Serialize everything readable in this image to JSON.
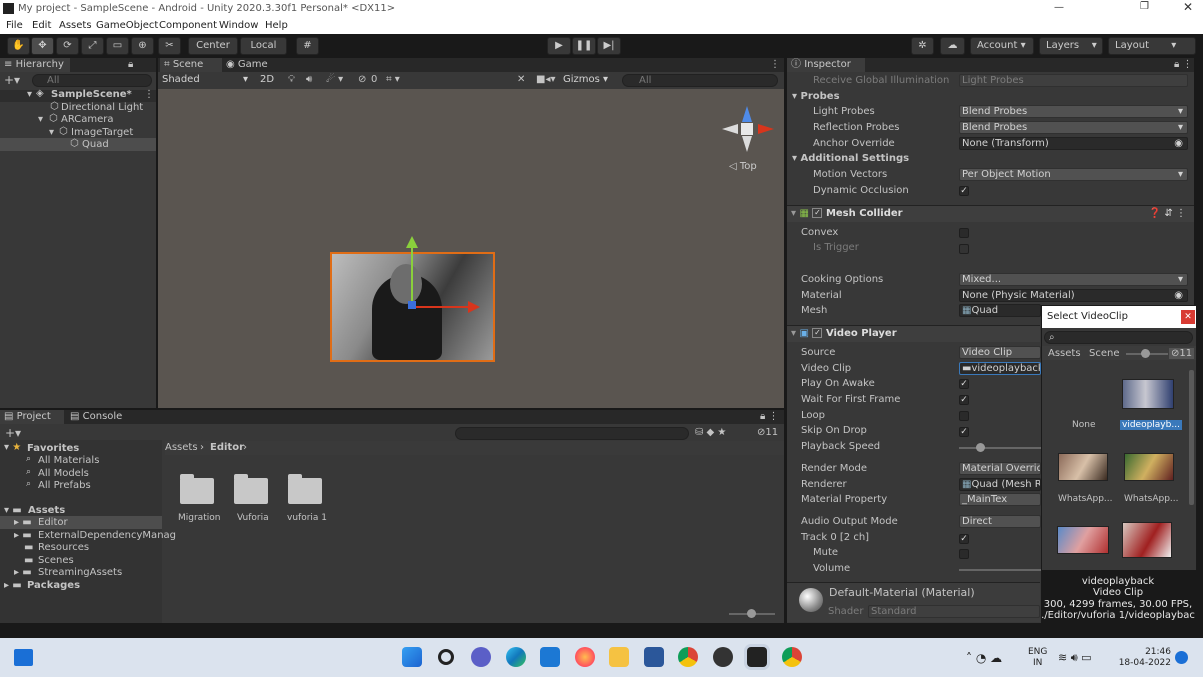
{
  "window": {
    "title": "My project - SampleScene - Android - Unity 2020.3.30f1 Personal* <DX11>"
  },
  "menu": [
    "File",
    "Edit",
    "Assets",
    "GameObject",
    "Component",
    "Window",
    "Help"
  ],
  "toolbar": {
    "center": "Center",
    "local": "Local",
    "account": "Account",
    "layers": "Layers",
    "layout": "Layout"
  },
  "hierarchy": {
    "tab": "Hierarchy",
    "search": "All",
    "scene": "SampleScene*",
    "items": [
      "Directional Light",
      "ARCamera",
      "ImageTarget",
      "Quad"
    ]
  },
  "scene": {
    "tab_scene": "Scene",
    "tab_game": "Game",
    "shading": "Shaded",
    "mode2d": "2D",
    "gizmos": "Gizmos",
    "search": "All",
    "hidden_count": "0",
    "view_label": "Top"
  },
  "project": {
    "tab_project": "Project",
    "tab_console": "Console",
    "favorites": "Favorites",
    "fav_items": [
      "All Materials",
      "All Models",
      "All Prefabs"
    ],
    "assets": "Assets",
    "asset_items": [
      "Editor",
      "ExternalDependencyManag",
      "Resources",
      "Scenes",
      "StreamingAssets"
    ],
    "packages": "Packages",
    "breadcrumb_root": "Assets",
    "breadcrumb_current": "Editor",
    "hidden_count": "11",
    "folders": [
      "Migration",
      "Vuforia",
      "vuforia 1"
    ]
  },
  "inspector": {
    "tab": "Inspector",
    "receive_gi": {
      "label": "Receive Global Illumination",
      "value": "Light Probes"
    },
    "probes": {
      "header": "Probes",
      "light_probes": {
        "label": "Light Probes",
        "value": "Blend Probes"
      },
      "reflection_probes": {
        "label": "Reflection Probes",
        "value": "Blend Probes"
      },
      "anchor": {
        "label": "Anchor Override",
        "value": "None (Transform)"
      }
    },
    "additional": {
      "header": "Additional Settings",
      "motion": {
        "label": "Motion Vectors",
        "value": "Per Object Motion"
      },
      "dynamic": {
        "label": "Dynamic Occlusion",
        "value": "✓"
      }
    },
    "mesh_collider": {
      "header": "Mesh Collider",
      "convex": "Convex",
      "trigger": "Is Trigger",
      "cooking": {
        "label": "Cooking Options",
        "value": "Mixed..."
      },
      "material": {
        "label": "Material",
        "value": "None (Physic Material)"
      },
      "mesh": {
        "label": "Mesh",
        "value": "Quad"
      }
    },
    "video_player": {
      "header": "Video Player",
      "source": {
        "label": "Source",
        "value": "Video Clip"
      },
      "clip": {
        "label": "Video Clip",
        "value": "videoplayback"
      },
      "play_on_awake": "Play On Awake",
      "wait_first_frame": "Wait For First Frame",
      "loop": "Loop",
      "skip_on_drop": "Skip On Drop",
      "playback_speed": "Playback Speed",
      "render_mode": {
        "label": "Render Mode",
        "value": "Material Override"
      },
      "renderer": {
        "label": "Renderer",
        "value": "Quad (Mesh Re"
      },
      "material_property": {
        "label": "Material Property",
        "value": "_MainTex"
      },
      "audio_output": {
        "label": "Audio Output Mode",
        "value": "Direct"
      },
      "track": "Track 0 [2 ch]",
      "mute": "Mute",
      "volume": "Volume"
    },
    "material": {
      "name": "Default-Material (Material)",
      "shader_label": "Shader",
      "shader_value": "Standard"
    }
  },
  "select_clip": {
    "title": "Select VideoClip",
    "tab_assets": "Assets",
    "tab_scene": "Scene",
    "hidden_count": "11",
    "items": [
      "None",
      "videoplayb...",
      "WhatsApp...",
      "WhatsApp..."
    ],
    "preview_name": "videoplayback",
    "preview_type": "Video Clip",
    "preview_info": "300, 4299 frames, 30.00 FPS,",
    "preview_path": "./Editor/vuforia 1/videoplaybac"
  },
  "taskbar": {
    "lang1": "ENG",
    "lang2": "IN",
    "time": "21:46",
    "date": "18-04-2022"
  }
}
